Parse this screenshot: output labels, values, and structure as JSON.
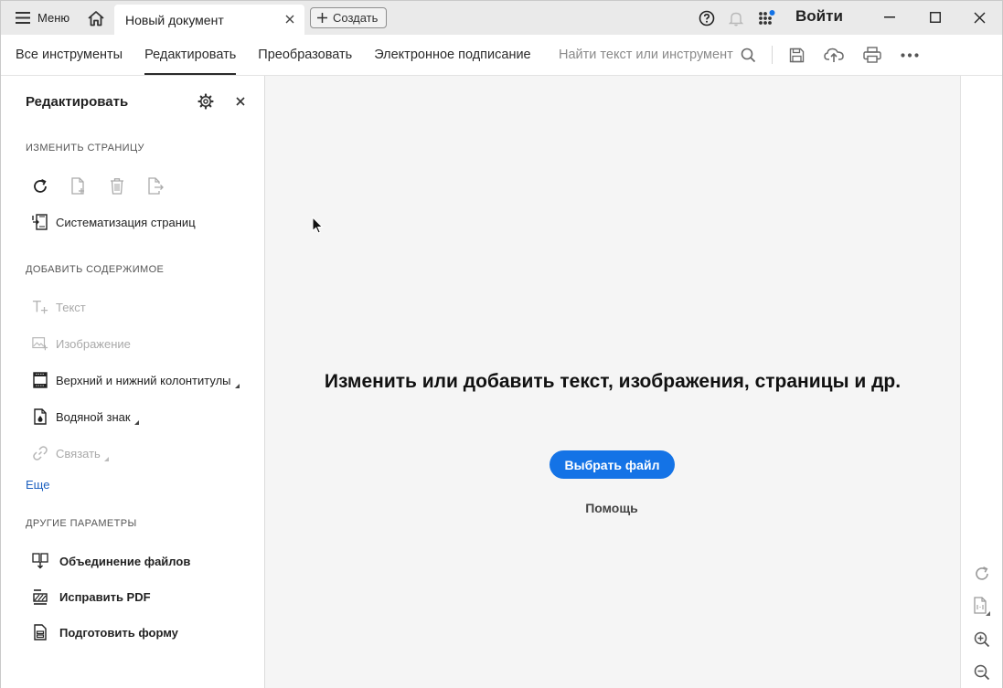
{
  "titlebar": {
    "menu_label": "Меню",
    "doc_tab_label": "Новый документ",
    "create_label": "Создать",
    "signin_label": "Войти",
    "notify_dot_color": "#1473e6"
  },
  "toolbar": {
    "tabs": [
      {
        "label": "Все инструменты"
      },
      {
        "label": "Редактировать",
        "active": true
      },
      {
        "label": "Преобразовать"
      },
      {
        "label": "Электронное подписание"
      }
    ],
    "search_placeholder": "Найти текст или инструмент"
  },
  "panel": {
    "title": "Редактировать",
    "section_modify": "ИЗМЕНИТЬ СТРАНИЦУ",
    "organize_label": "Систематизация страниц",
    "section_add": "ДОБАВИТЬ СОДЕРЖИМОЕ",
    "add_items": [
      {
        "label": "Текст"
      },
      {
        "label": "Изображение"
      },
      {
        "label": "Верхний и нижний колонтитулы"
      },
      {
        "label": "Водяной знак"
      },
      {
        "label": "Связать"
      }
    ],
    "more_label": "Еще",
    "section_other": "ДРУГИЕ ПАРАМЕТРЫ",
    "other_items": [
      {
        "label": "Объединение файлов"
      },
      {
        "label": "Исправить PDF"
      },
      {
        "label": "Подготовить форму"
      }
    ]
  },
  "main": {
    "heading": "Изменить или добавить текст, изображения, страницы и др.",
    "choose_file_label": "Выбрать файл",
    "help_label": "Помощь",
    "accent_color": "#1473e6"
  }
}
